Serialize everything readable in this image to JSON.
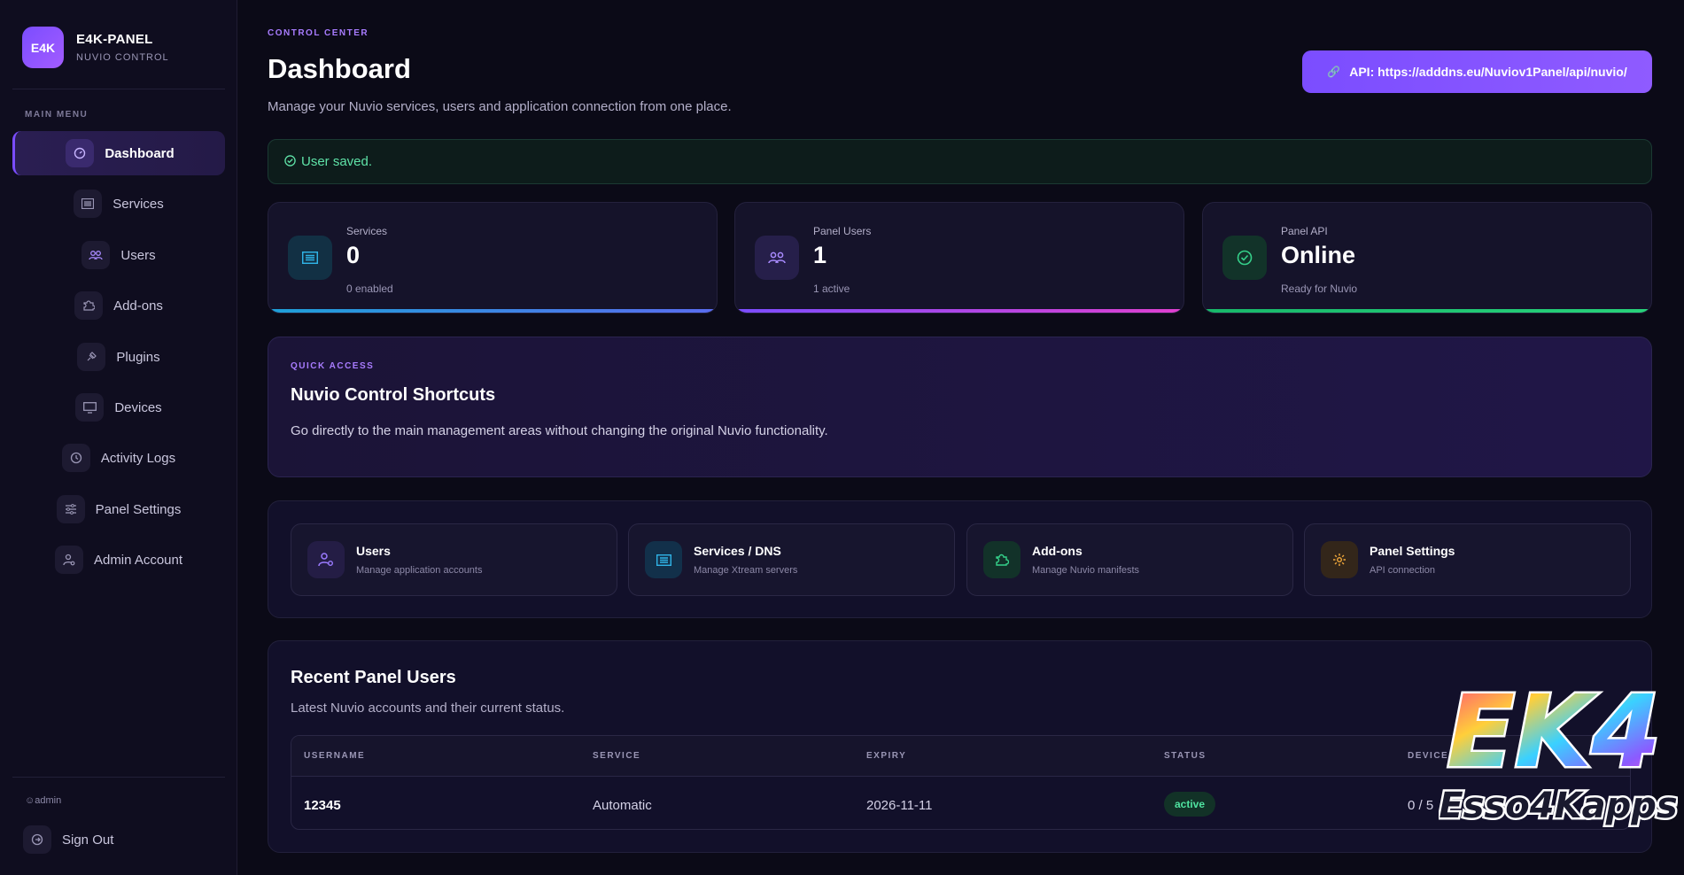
{
  "brand": {
    "logo_text": "E4K",
    "title": "E4K-PANEL",
    "subtitle": "NUVIO CONTROL"
  },
  "sidebar": {
    "section_label": "MAIN MENU",
    "items": [
      {
        "label": "Dashboard",
        "icon": "gauge-icon",
        "active": true
      },
      {
        "label": "Services",
        "icon": "server-list-icon"
      },
      {
        "label": "Users",
        "icon": "users-icon"
      },
      {
        "label": "Add-ons",
        "icon": "puzzle-icon"
      },
      {
        "label": "Plugins",
        "icon": "plug-icon"
      },
      {
        "label": "Devices",
        "icon": "monitor-icon"
      },
      {
        "label": "Activity Logs",
        "icon": "history-icon"
      },
      {
        "label": "Panel Settings",
        "icon": "sliders-icon"
      },
      {
        "label": "Admin Account",
        "icon": "user-gear-icon"
      }
    ],
    "current_user": "admin",
    "signout_label": "Sign Out"
  },
  "header": {
    "eyebrow": "CONTROL CENTER",
    "title": "Dashboard",
    "subtitle": "Manage your Nuvio services, users and application connection from one place.",
    "api_button": "API: https://adddns.eu/Nuviov1Panel/api/nuvio/"
  },
  "alert": {
    "text": "User saved.",
    "color": "#5fe3a8"
  },
  "stats": [
    {
      "label": "Services",
      "value": "0",
      "note": "0 enabled",
      "icon": "server-list-icon",
      "accent": "#2f9bd6"
    },
    {
      "label": "Panel Users",
      "value": "1",
      "note": "1 active",
      "icon": "users-icon",
      "accent": "#b03ee0"
    },
    {
      "label": "Panel API",
      "value": "Online",
      "note": "Ready for Nuvio",
      "icon": "check-circle-icon",
      "accent": "#21c76a"
    }
  ],
  "quick_access": {
    "eyebrow": "QUICK ACCESS",
    "title": "Nuvio Control Shortcuts",
    "description": "Go directly to the main management areas without changing the original Nuvio functionality."
  },
  "shortcuts": [
    {
      "title": "Users",
      "subtitle": "Manage application accounts",
      "icon": "user-gear-icon",
      "color": "#9b7bff"
    },
    {
      "title": "Services / DNS",
      "subtitle": "Manage Xtream servers",
      "icon": "server-list-icon",
      "color": "#2fb3e6"
    },
    {
      "title": "Add-ons",
      "subtitle": "Manage Nuvio manifests",
      "icon": "puzzle-icon",
      "color": "#35d18a"
    },
    {
      "title": "Panel Settings",
      "subtitle": "API connection",
      "icon": "gear-icon",
      "color": "#f0a73a"
    }
  ],
  "recent_users": {
    "title": "Recent Panel Users",
    "subtitle": "Latest Nuvio accounts and their current status.",
    "columns": [
      "USERNAME",
      "SERVICE",
      "EXPIRY",
      "STATUS",
      "DEVICES"
    ],
    "rows": [
      {
        "username": "12345",
        "service": "Automatic",
        "expiry": "2026-11-11",
        "status": "active",
        "devices": "0 / 5"
      }
    ]
  },
  "watermark": {
    "line1": "EK4",
    "line2": "Esso4Kapps"
  }
}
